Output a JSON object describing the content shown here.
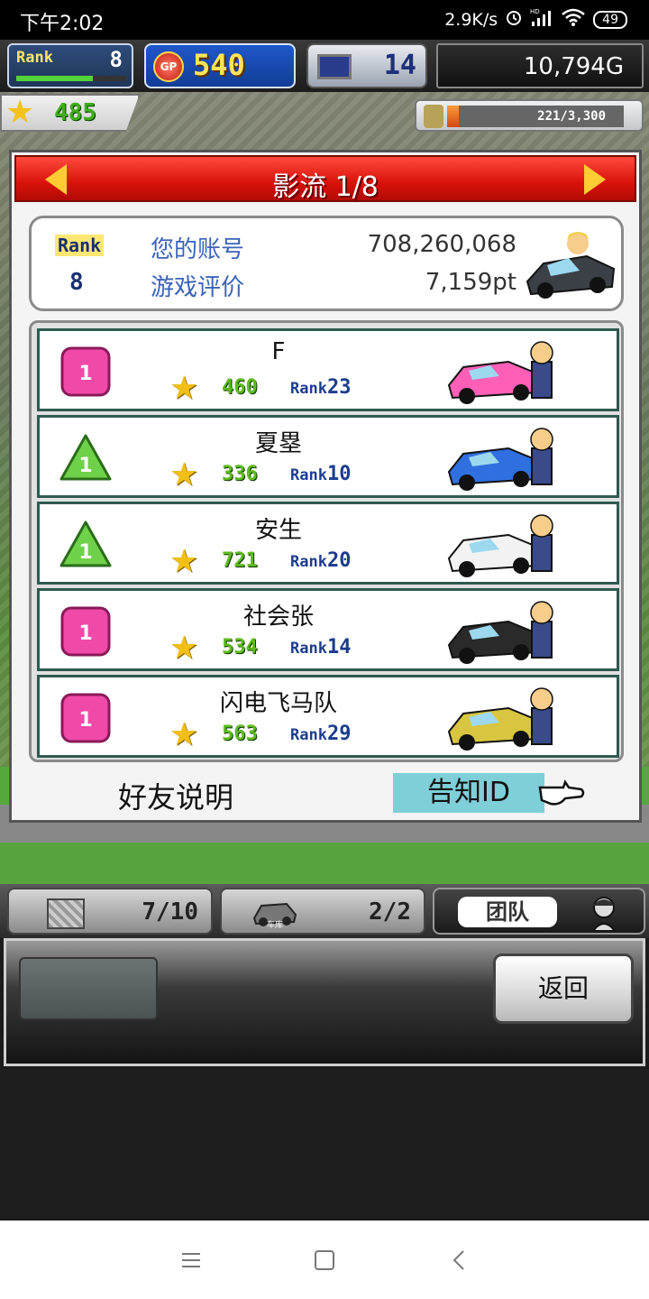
{
  "status_bar": {
    "time": "下午2:02",
    "net_speed": "2.9K/s",
    "hd_label": "HD",
    "battery": "49"
  },
  "hud": {
    "rank_label": "Rank",
    "rank_value": "8",
    "rank_progress": 0.7,
    "gp_label": "GP",
    "gp_value": "540",
    "research_value": "14",
    "money": "10,794G",
    "stars": "485",
    "fuel_text": "221/3,300",
    "fuel_fraction": 0.067
  },
  "panel": {
    "title": "影流 1/8",
    "account": {
      "rank_label": "Rank",
      "rank_value": "8",
      "account_label": "您的账号",
      "account_value": "708,260,068",
      "rating_label": "游戏评价",
      "rating_value": "7,159pt"
    },
    "rank_prefix": "Rank",
    "friends": [
      {
        "badge": "1",
        "badge_shape": "square",
        "badge_color": "#f04aa8",
        "name": "F",
        "stars": "460",
        "rank": "23",
        "car_color": "#ff5fb7"
      },
      {
        "badge": "1",
        "badge_shape": "triangle",
        "badge_color": "#6fd14a",
        "name": "夏塁",
        "stars": "336",
        "rank": "10",
        "car_color": "#2f6fdf"
      },
      {
        "badge": "1",
        "badge_shape": "triangle",
        "badge_color": "#6fd14a",
        "name": "安生",
        "stars": "721",
        "rank": "20",
        "car_color": "#f2f2f2"
      },
      {
        "badge": "1",
        "badge_shape": "square",
        "badge_color": "#f04aa8",
        "name": "社会张",
        "stars": "534",
        "rank": "14",
        "car_color": "#2a2a2a"
      },
      {
        "badge": "1",
        "badge_shape": "square",
        "badge_color": "#f04aa8",
        "name": "闪电飞马队",
        "stars": "563",
        "rank": "29",
        "car_color": "#d9c640"
      }
    ],
    "friend_help": "好友说明",
    "notify_id": "告知ID"
  },
  "tabbar": {
    "items_count": "7/10",
    "garage_label": "车库",
    "garage_count": "2/2",
    "team_label": "团队"
  },
  "command": {
    "back_label": "返回"
  },
  "colors": {
    "header_red": "#d9120a",
    "accent_blue": "#3a63b8",
    "notify_bg": "#7ecfd8"
  }
}
